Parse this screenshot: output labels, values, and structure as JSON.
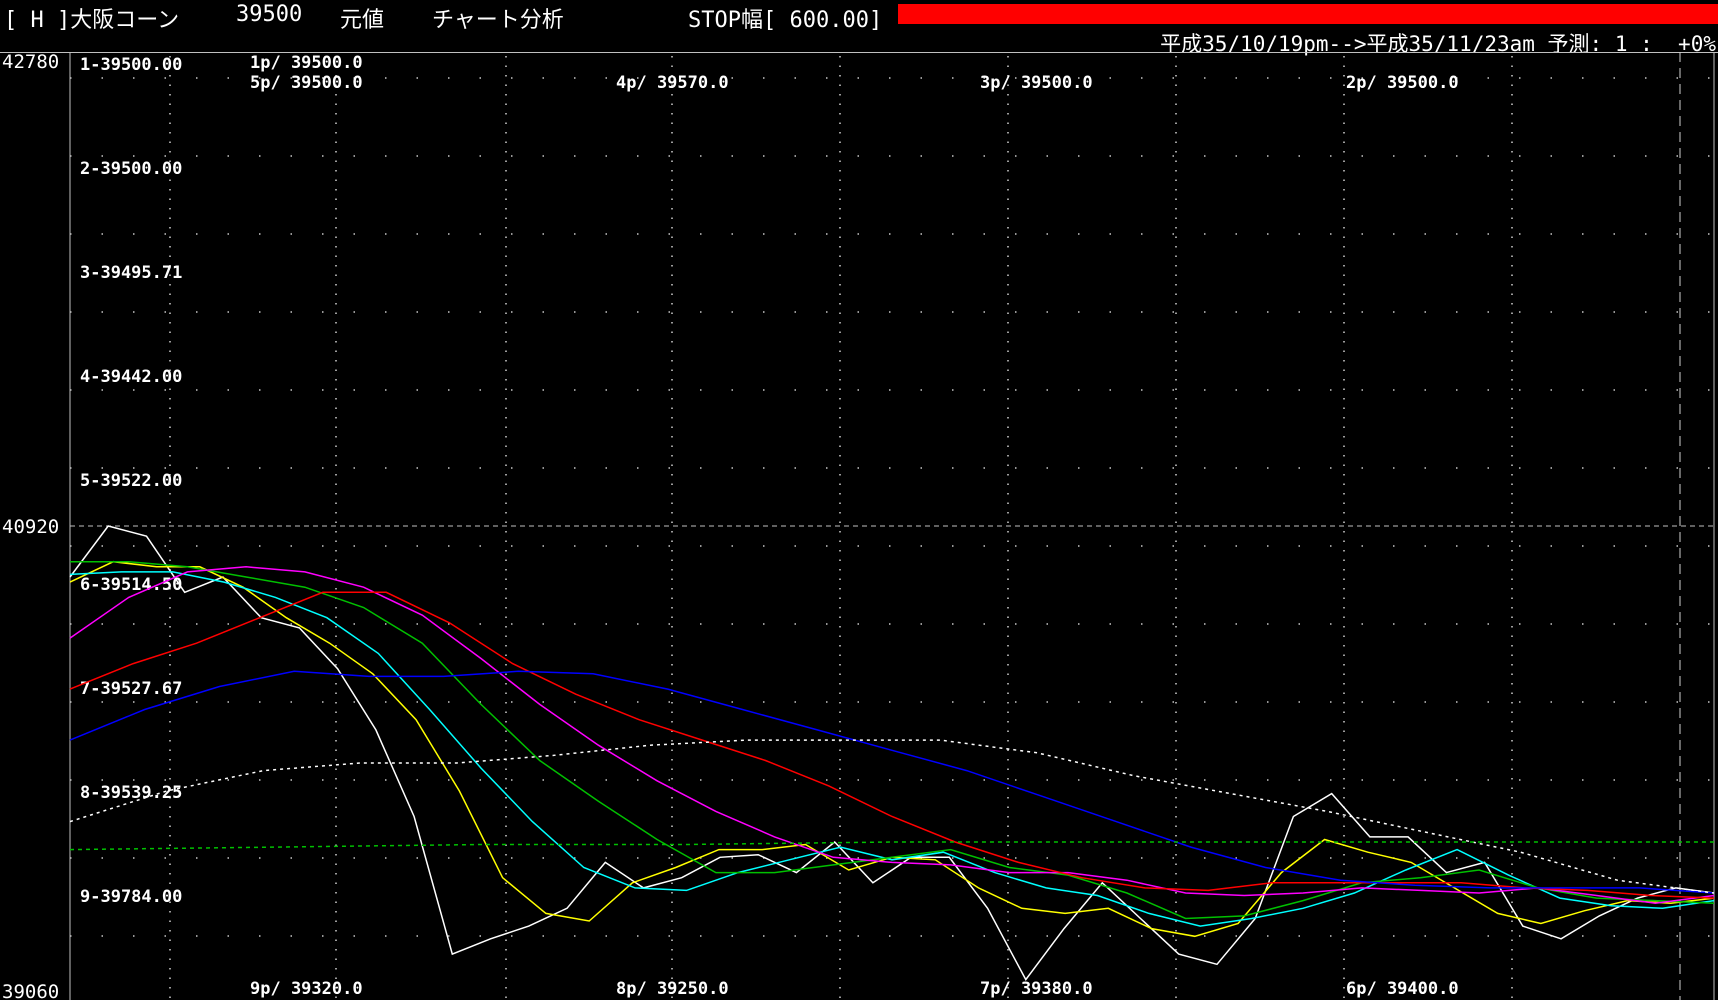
{
  "header": {
    "market": "[ H ]大阪コーン",
    "price": "39500",
    "base_label": "元値",
    "analysis_label": "チャート分析",
    "stop_label": "STOP幅[ 600.00]",
    "alert_color": "#ff0000",
    "period_range": "平成35/10/19pm-->平成35/11/23am 予測: 1 :  +0%"
  },
  "chart_data": {
    "type": "line",
    "ylim": [
      39060,
      42780
    ],
    "y_ticks": [
      "42780",
      "40920",
      "39060"
    ],
    "levels": [
      "1-39500.00",
      "2-39500.00",
      "3-39495.71",
      "4-39442.00",
      "5-39522.00",
      "6-39514.50",
      "7-39527.67",
      "8-39539.25",
      "9-39784.00"
    ],
    "period_labels_top": [
      "1p/ 39500.0",
      "5p/ 39500.0",
      "4p/ 39570.0",
      "3p/ 39500.0",
      "2p/ 39500.0"
    ],
    "period_labels_bottom": [
      "9p/ 39320.0",
      "8p/ 39250.0",
      "7p/ 39380.0",
      "6p/ 39400.0"
    ],
    "series": [
      {
        "color": "#ffffff",
        "style": "solid",
        "values": [
          40720,
          40920,
          40880,
          40660,
          40720,
          40560,
          40520,
          40360,
          40120,
          39780,
          39240,
          39300,
          39350,
          39420,
          39600,
          39500,
          39540,
          39620,
          39630,
          39560,
          39680,
          39520,
          39620,
          39620,
          39420,
          39140,
          39340,
          39520,
          39380,
          39240,
          39200,
          39380,
          39780,
          39870,
          39700,
          39700,
          39560,
          39600,
          39350,
          39300,
          39390,
          39460,
          39500,
          39480
        ]
      },
      {
        "color": "#ffff00",
        "style": "solid",
        "values": [
          40700,
          40780,
          40760,
          40760,
          40680,
          40560,
          40460,
          40340,
          40160,
          39880,
          39540,
          39400,
          39370,
          39520,
          39580,
          39650,
          39650,
          39670,
          39570,
          39620,
          39610,
          39500,
          39420,
          39400,
          39420,
          39340,
          39310,
          39360,
          39560,
          39690,
          39640,
          39600,
          39500,
          39400,
          39360,
          39410,
          39450,
          39440,
          39460
        ]
      },
      {
        "color": "#00ffff",
        "style": "solid",
        "values": [
          40730,
          40740,
          40740,
          40700,
          40640,
          40560,
          40420,
          40200,
          39970,
          39760,
          39580,
          39500,
          39490,
          39560,
          39610,
          39660,
          39610,
          39640,
          39560,
          39500,
          39470,
          39400,
          39350,
          39380,
          39420,
          39480,
          39570,
          39650,
          39550,
          39460,
          39430,
          39420,
          39450
        ]
      },
      {
        "color": "#00c000",
        "style": "solid",
        "values": [
          40780,
          40780,
          40760,
          40720,
          40680,
          40600,
          40460,
          40220,
          40000,
          39840,
          39690,
          39560,
          39560,
          39590,
          39620,
          39650,
          39580,
          39550,
          39480,
          39380,
          39390,
          39450,
          39520,
          39540,
          39570,
          39500,
          39460,
          39450,
          39440
        ]
      },
      {
        "color": "#ff00ff",
        "style": "solid",
        "values": [
          40480,
          40640,
          40740,
          40760,
          40740,
          40680,
          40570,
          40400,
          40220,
          40060,
          39920,
          39800,
          39700,
          39620,
          39600,
          39590,
          39560,
          39560,
          39530,
          39480,
          39470,
          39480,
          39500,
          39490,
          39480,
          39500,
          39470,
          39440,
          39470
        ]
      },
      {
        "color": "#ff0000",
        "style": "solid",
        "values": [
          40280,
          40380,
          40460,
          40560,
          40660,
          40660,
          40540,
          40380,
          40260,
          40160,
          40080,
          40000,
          39900,
          39780,
          39680,
          39600,
          39540,
          39500,
          39490,
          39520,
          39520,
          39520,
          39520,
          39500,
          39490,
          39470,
          39460
        ]
      },
      {
        "color": "#0000ff",
        "style": "solid",
        "values": [
          40080,
          40200,
          40290,
          40350,
          40330,
          40330,
          40350,
          40340,
          40280,
          40200,
          40120,
          40040,
          39960,
          39860,
          39760,
          39660,
          39580,
          39530,
          39510,
          39500,
          39500,
          39500,
          39480
        ]
      },
      {
        "color": "#ffffff",
        "style": "dotted",
        "values": [
          39760,
          39880,
          39960,
          39990,
          39990,
          40020,
          40060,
          40080,
          40080,
          40080,
          40030,
          39940,
          39870,
          39800,
          39720,
          39640,
          39530,
          39480
        ]
      },
      {
        "color": "#00c000",
        "style": "dashed",
        "values": [
          39650,
          39660,
          39670,
          39670,
          39680,
          39680,
          39680,
          39680,
          39680
        ]
      }
    ]
  }
}
